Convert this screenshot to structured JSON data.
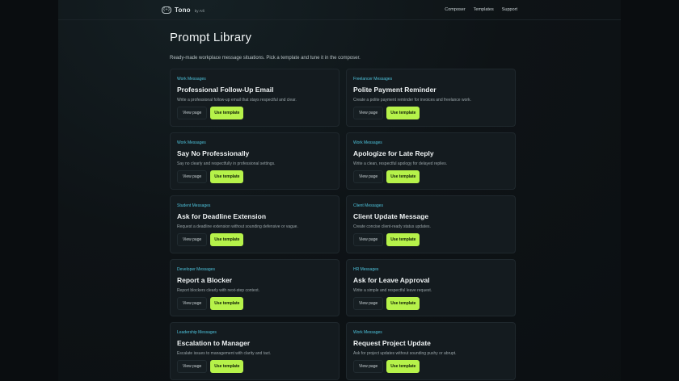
{
  "brand": {
    "logo_text": "{+}",
    "name": "Tono",
    "by": "by Arli"
  },
  "nav": [
    "Composer",
    "Templates",
    "Support"
  ],
  "page": {
    "title": "Prompt Library",
    "subtitle": "Ready-made workplace message situations. Pick a template and tune it in the composer."
  },
  "colors": {
    "accent": "#b6f24a",
    "category": "#4ec3dc",
    "card_bg": "#141b1f",
    "page_bg": "#0c1014"
  },
  "cards": [
    {
      "category": "Work Messages",
      "title": "Professional Follow-Up Email",
      "desc": "Write a professional follow-up email that stays respectful and clear.",
      "view": "View page",
      "use": "Use template"
    },
    {
      "category": "Freelancer Messages",
      "title": "Polite Payment Reminder",
      "desc": "Create a polite payment reminder for invoices and freelance work.",
      "view": "View page",
      "use": "Use template"
    },
    {
      "category": "Work Messages",
      "title": "Say No Professionally",
      "desc": "Say no clearly and respectfully in professional settings.",
      "view": "View page",
      "use": "Use template"
    },
    {
      "category": "Work Messages",
      "title": "Apologize for Late Reply",
      "desc": "Write a clean, respectful apology for delayed replies.",
      "view": "View page",
      "use": "Use template"
    },
    {
      "category": "Student Messages",
      "title": "Ask for Deadline Extension",
      "desc": "Request a deadline extension without sounding defensive or vague.",
      "view": "View page",
      "use": "Use template"
    },
    {
      "category": "Client Messages",
      "title": "Client Update Message",
      "desc": "Create concise client-ready status updates.",
      "view": "View page",
      "use": "Use template"
    },
    {
      "category": "Developer Messages",
      "title": "Report a Blocker",
      "desc": "Report blockers clearly with next-step context.",
      "view": "View page",
      "use": "Use template"
    },
    {
      "category": "HR Messages",
      "title": "Ask for Leave Approval",
      "desc": "Write a simple and respectful leave request.",
      "view": "View page",
      "use": "Use template"
    },
    {
      "category": "Leadership Messages",
      "title": "Escalation to Manager",
      "desc": "Escalate issues to management with clarity and tact.",
      "view": "View page",
      "use": "Use template"
    },
    {
      "category": "Work Messages",
      "title": "Request Project Update",
      "desc": "Ask for project updates without sounding pushy or abrupt.",
      "view": "View page",
      "use": "Use template"
    }
  ]
}
